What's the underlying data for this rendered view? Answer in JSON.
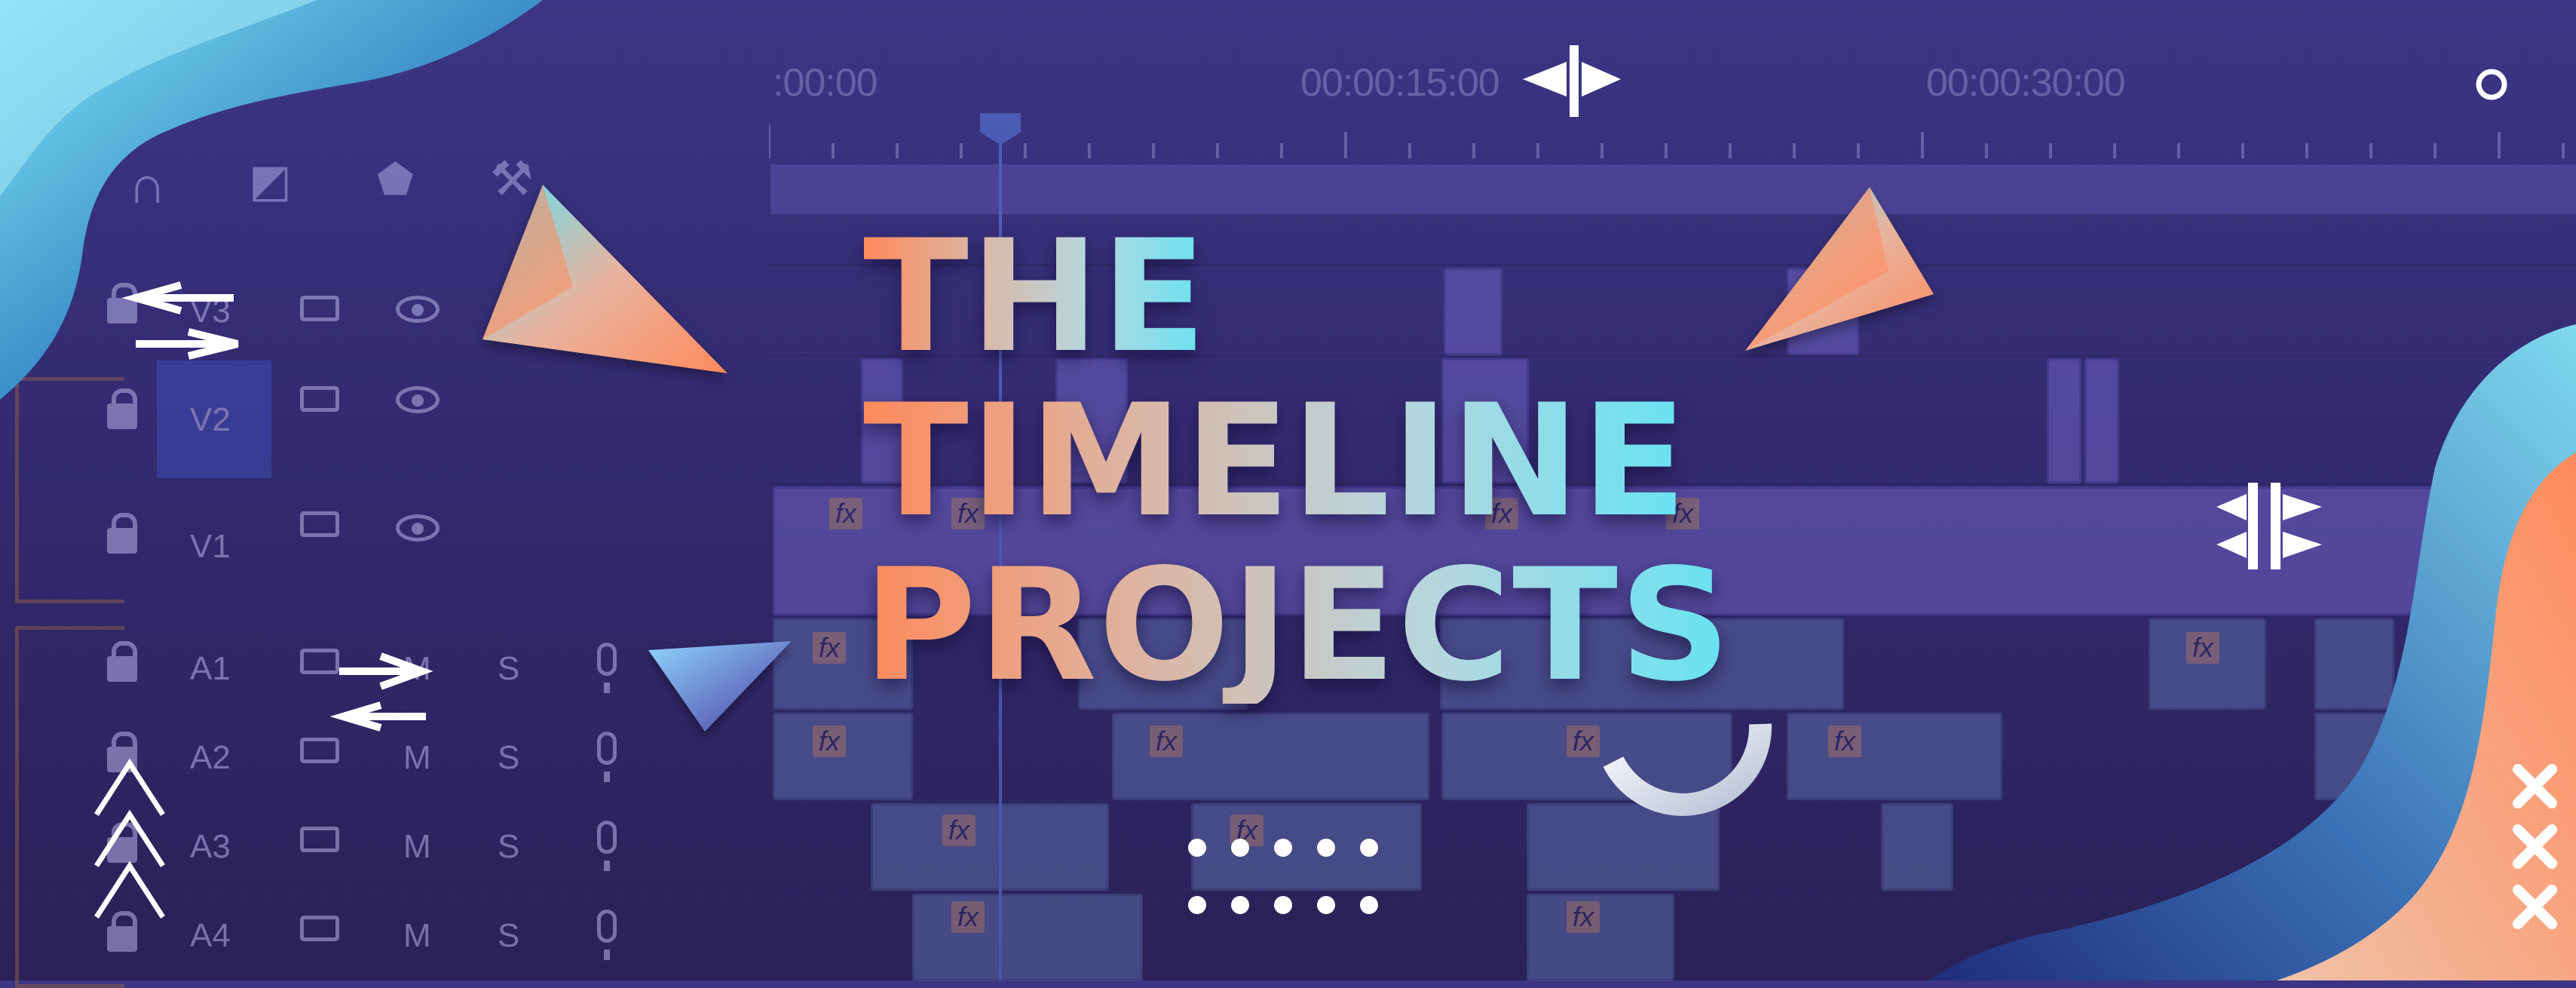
{
  "title": {
    "line1": "THE",
    "line2": "TIMELINE",
    "line3": "PROJECTS"
  },
  "timeline": {
    "timecodes": [
      ":00:00",
      "00:00:15:00",
      "00:00:30:00"
    ],
    "tracks": [
      "V3",
      "V2",
      "V1",
      "A1",
      "A2",
      "A3",
      "A4"
    ],
    "mute_label": "M",
    "solo_label": "S",
    "fx_label": "fx"
  },
  "icons": {
    "toolbar": [
      "magnet-icon",
      "linked-selection-icon",
      "marker-icon",
      "wrench-icon"
    ],
    "track_controls": [
      "lock-icon",
      "film-icon",
      "eye-icon",
      "mic-icon"
    ],
    "decorations": [
      "triangle-icon",
      "swap-arrows-icon",
      "chevrons-icon",
      "hash-icon",
      "x-mark-icon",
      "ring-icon",
      "arc-icon",
      "dots-icon"
    ]
  },
  "colors": {
    "background": "#3c3585",
    "title_start": "#ff8a5c",
    "title_end": "#66e3f2",
    "wave_cyan": "#6fd3ee",
    "wave_orange": "#ff8a5c",
    "clip": "#6e62c2"
  }
}
